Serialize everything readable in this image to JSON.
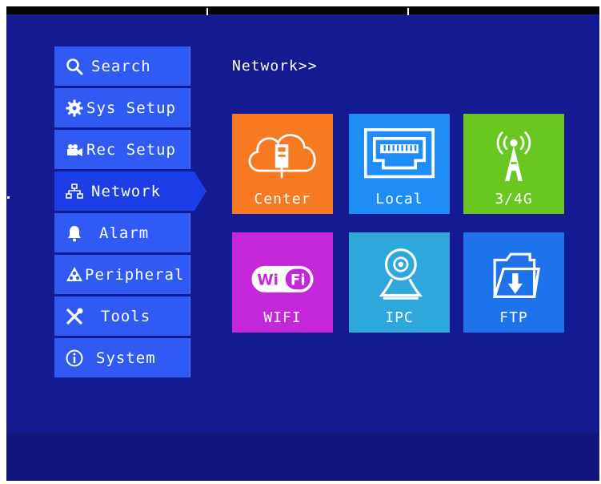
{
  "breadcrumb": "Network>>",
  "sidebar": {
    "items": [
      {
        "label": "Search",
        "icon": "search-icon"
      },
      {
        "label": "Sys Setup",
        "icon": "gear-icon"
      },
      {
        "label": "Rec Setup",
        "icon": "camera-icon"
      },
      {
        "label": "Network",
        "icon": "network-icon",
        "active": true
      },
      {
        "label": "Alarm",
        "icon": "bell-icon"
      },
      {
        "label": "Peripheral",
        "icon": "peripheral-icon"
      },
      {
        "label": "Tools",
        "icon": "tools-icon"
      },
      {
        "label": "System",
        "icon": "info-icon"
      }
    ]
  },
  "tiles": [
    {
      "label": "Center",
      "color": "#f77a22",
      "icon": "cloud-icon"
    },
    {
      "label": "Local",
      "color": "#1e8df7",
      "icon": "ethernet-port-icon"
    },
    {
      "label": "3/4G",
      "color": "#68c81f",
      "icon": "cell-tower-icon"
    },
    {
      "label": "WIFI",
      "color": "#c426d9",
      "icon": "wifi-icon",
      "badge": "WiFi"
    },
    {
      "label": "IPC",
      "color": "#2ea7db",
      "icon": "webcam-icon"
    },
    {
      "label": "FTP",
      "color": "#1e73ec",
      "icon": "folder-download-icon"
    }
  ],
  "colors": {
    "background": "#131a92",
    "menu_item": "#2f5af4",
    "menu_item_active": "#1c3ee6"
  }
}
